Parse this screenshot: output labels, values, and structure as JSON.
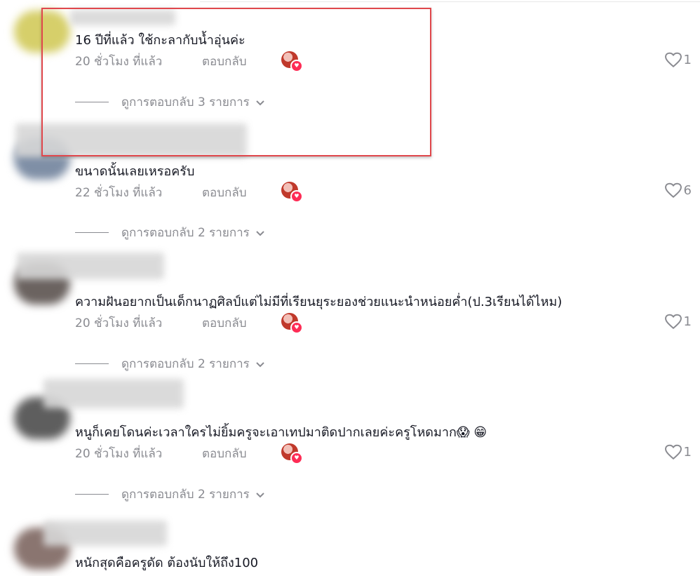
{
  "comments": [
    {
      "text": "16 ปีที่แล้ว ใช้กะลากับน้ำอุ่นค่ะ",
      "time": "20 ชั่วโมง ที่แล้ว",
      "reply_label": "ตอบกลับ",
      "likes": "1",
      "view_replies": "ดูการตอบกลับ 3 รายการ"
    },
    {
      "text": "ขนาดนั้นเลยเหรอครับ",
      "time": "22 ชั่วโมง ที่แล้ว",
      "reply_label": "ตอบกลับ",
      "likes": "6",
      "view_replies": "ดูการตอบกลับ 2 รายการ"
    },
    {
      "text": "ความฝันอยากเป็นเด็กนาฏศิลป์แต่ไม่มีที่เรียนยุระยองช่วยแนะนำหน่อยค่ำ(ป.3เรียนได้ไหม)",
      "time": "20 ชั่วโมง ที่แล้ว",
      "reply_label": "ตอบกลับ",
      "likes": "1",
      "view_replies": "ดูการตอบกลับ 2 รายการ"
    },
    {
      "text": "หนูก็เคยโดนค่ะเวลาใครไม่ยิ้มครูจะเอาเทปมาติดปากเลยค่ะครูโหดมาก😱 😁",
      "time": "20 ชั่วโมง ที่แล้ว",
      "reply_label": "ตอบกลับ",
      "likes": "1",
      "view_replies": "ดูการตอบกลับ 2 รายการ"
    },
    {
      "text": "หนักสุดคือครูดัด ต้องนับให้ถึง100"
    }
  ],
  "icons": {
    "like": "heart-outline-icon",
    "expand": "chevron-down-icon",
    "creator_liked": "heart-badge-icon"
  },
  "colors": {
    "highlight_border": "#e0474c",
    "badge": "#fe2c55",
    "meta_text": "#8a8b91"
  }
}
